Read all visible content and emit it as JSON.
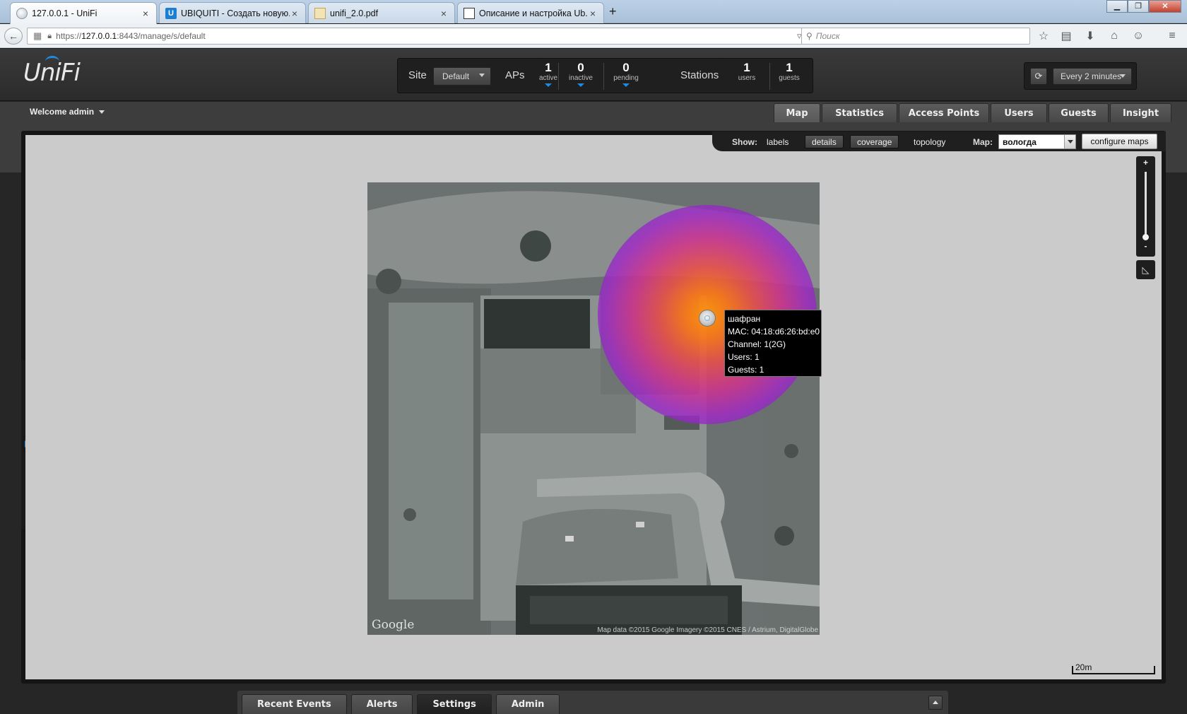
{
  "browser": {
    "tabs": [
      {
        "label": "127.0.0.1 - UniFi",
        "icon": "globe-icon"
      },
      {
        "label": "UBIQUITI - Создать новую...",
        "icon": "ubiquiti-icon"
      },
      {
        "label": "unifi_2.0.pdf",
        "icon": "pdf-icon"
      },
      {
        "label": "Описание и настройка Ub...",
        "icon": "windows-icon"
      }
    ],
    "url_prefix": "https://",
    "url_host": "127.0.0.1",
    "url_rest": ":8443/manage/s/default",
    "search_placeholder": "Поиск"
  },
  "header": {
    "logo": "UniFi",
    "site_label": "Site",
    "site_value": "Default",
    "aps_label": "APs",
    "aps": [
      {
        "num": "1",
        "label": "active"
      },
      {
        "num": "0",
        "label": "inactive"
      },
      {
        "num": "0",
        "label": "pending"
      }
    ],
    "stations_label": "Stations",
    "stations": [
      {
        "num": "1",
        "label": "users"
      },
      {
        "num": "1",
        "label": "guests"
      }
    ],
    "refresh_value": "Every 2 minutes"
  },
  "welcome": "Welcome admin",
  "main_tabs": [
    "Map",
    "Statistics",
    "Access Points",
    "Users",
    "Guests",
    "Insight"
  ],
  "toolbar": {
    "show_label": "Show:",
    "labels": "labels",
    "details": "details",
    "coverage": "coverage",
    "topology": "topology",
    "map_label": "Map:",
    "map_value": "вологда",
    "configure": "configure maps"
  },
  "zoom": {
    "plus": "+",
    "minus": "-"
  },
  "map": {
    "google": "Google",
    "attribution": "Map data ©2015 Google  Imagery ©2015 CNES / Astrium, DigitalGlobe",
    "scale": "20m"
  },
  "ap_tooltip": {
    "name": "шафран",
    "mac": "MAC: 04:18:d6:26:bd:e0",
    "channel": "Channel: 1(2G)",
    "users": "Users: 1",
    "guests": "Guests: 1"
  },
  "bottom_tabs": [
    "Recent Events",
    "Alerts",
    "Settings",
    "Admin"
  ]
}
